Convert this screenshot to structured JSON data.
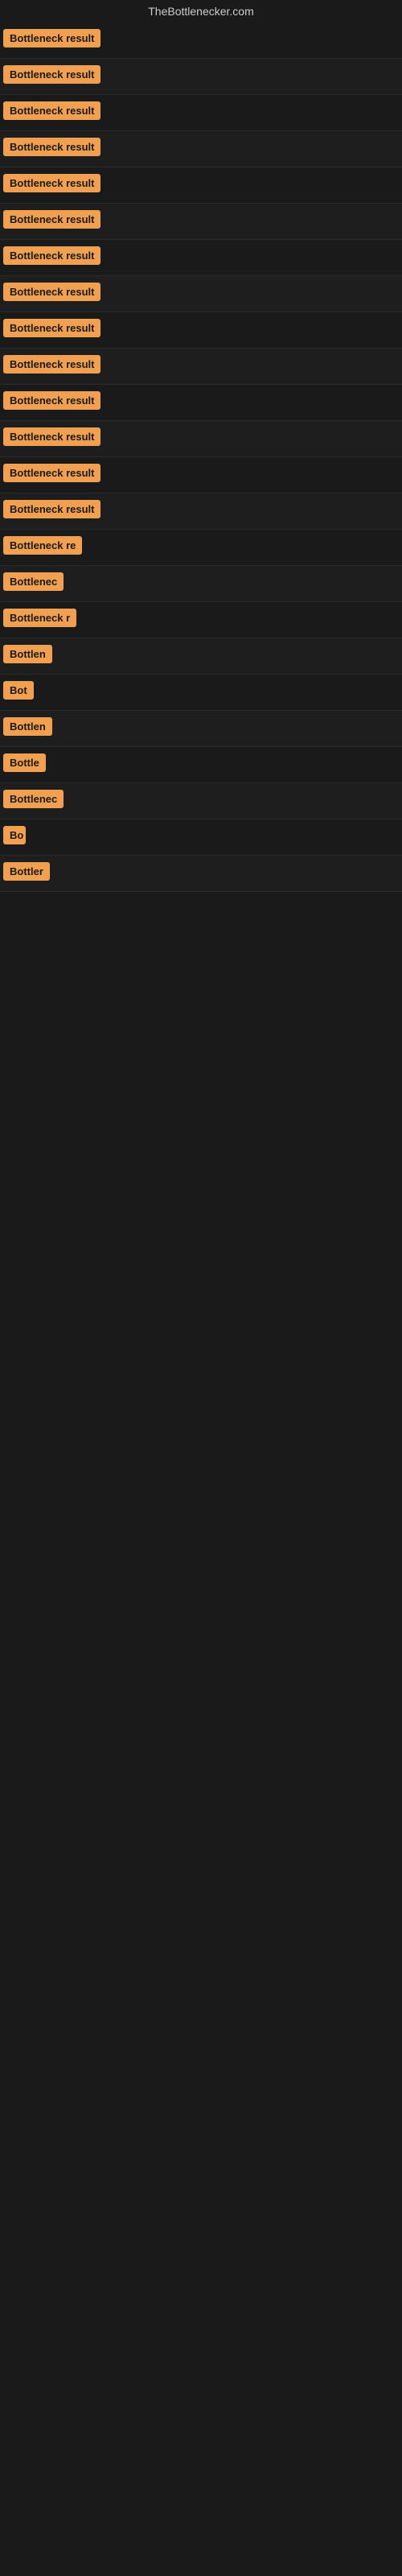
{
  "site": {
    "title": "TheBottlenecker.com"
  },
  "results": [
    {
      "label": "Bottleneck result",
      "width": 170
    },
    {
      "label": "Bottleneck result",
      "width": 170
    },
    {
      "label": "Bottleneck result",
      "width": 170
    },
    {
      "label": "Bottleneck result",
      "width": 170
    },
    {
      "label": "Bottleneck result",
      "width": 170
    },
    {
      "label": "Bottleneck result",
      "width": 170
    },
    {
      "label": "Bottleneck result",
      "width": 170
    },
    {
      "label": "Bottleneck result",
      "width": 170
    },
    {
      "label": "Bottleneck result",
      "width": 170
    },
    {
      "label": "Bottleneck result",
      "width": 170
    },
    {
      "label": "Bottleneck result",
      "width": 170
    },
    {
      "label": "Bottleneck result",
      "width": 170
    },
    {
      "label": "Bottleneck result",
      "width": 170
    },
    {
      "label": "Bottleneck result",
      "width": 170
    },
    {
      "label": "Bottleneck re",
      "width": 120
    },
    {
      "label": "Bottlenec",
      "width": 85
    },
    {
      "label": "Bottleneck r",
      "width": 100
    },
    {
      "label": "Bottlen",
      "width": 72
    },
    {
      "label": "Bot",
      "width": 40
    },
    {
      "label": "Bottlen",
      "width": 72
    },
    {
      "label": "Bottle",
      "width": 58
    },
    {
      "label": "Bottlenec",
      "width": 85
    },
    {
      "label": "Bo",
      "width": 28
    },
    {
      "label": "Bottler",
      "width": 62
    }
  ]
}
